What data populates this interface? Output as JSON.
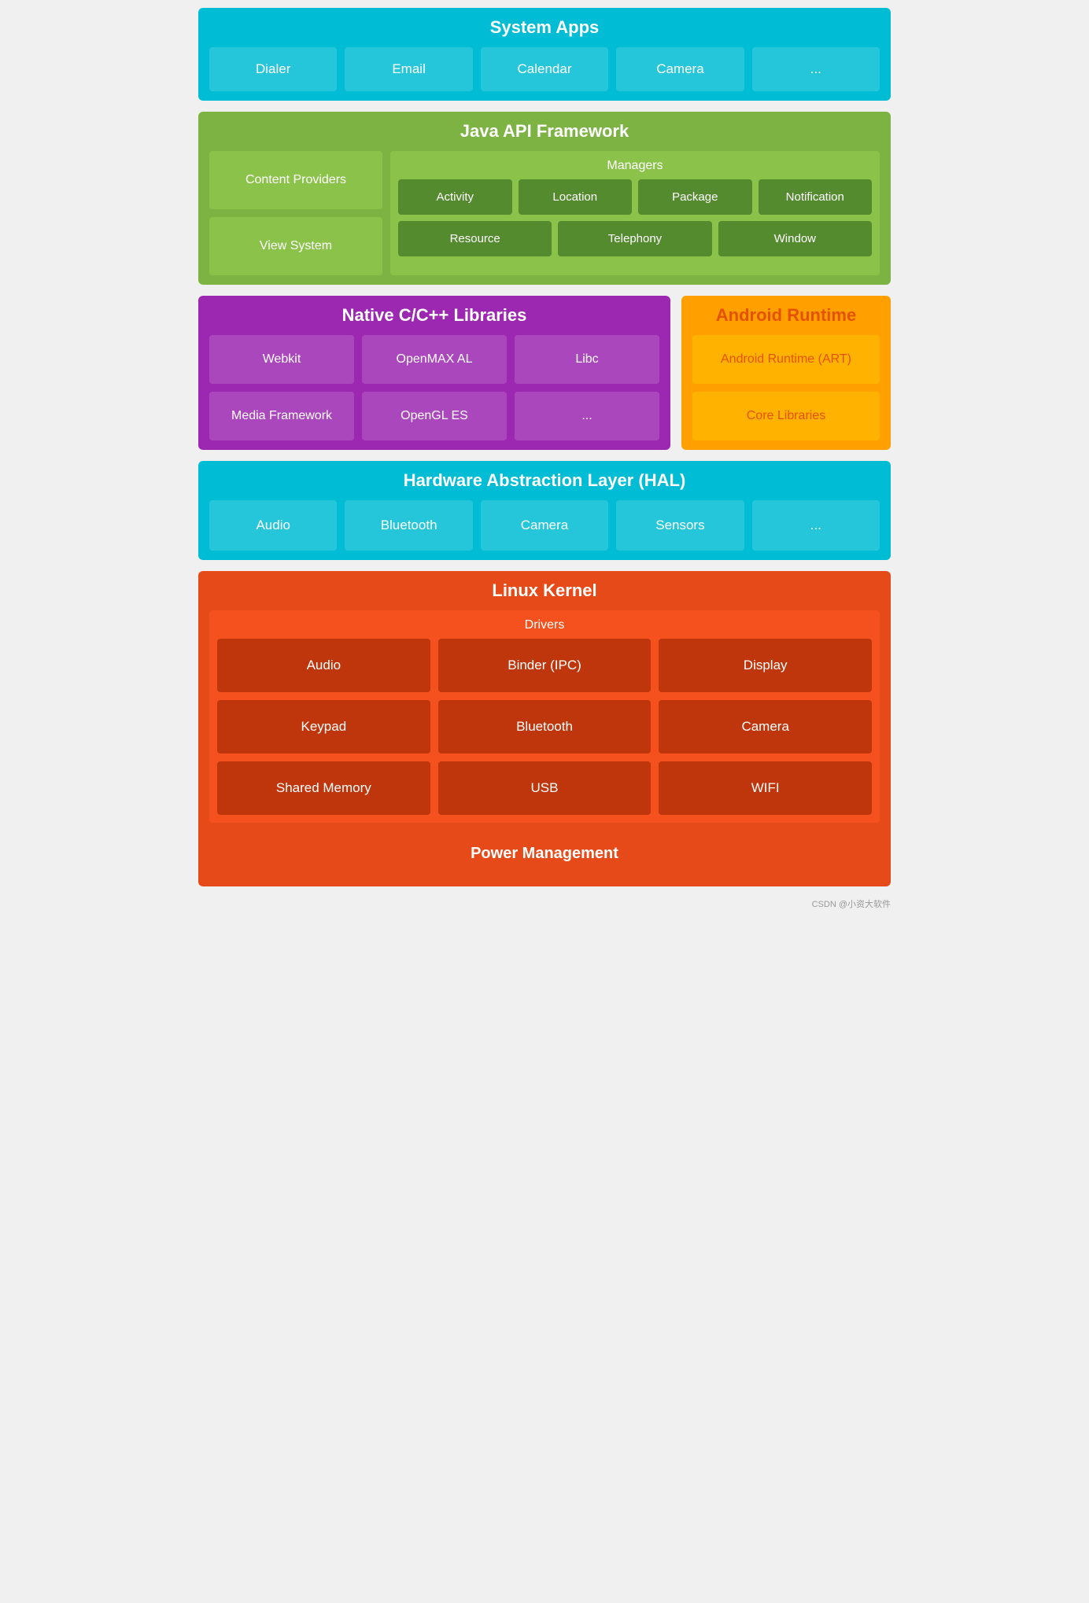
{
  "systemApps": {
    "title": "System Apps",
    "cards": [
      "Dialer",
      "Email",
      "Calendar",
      "Camera",
      "..."
    ]
  },
  "javaApi": {
    "title": "Java API Framework",
    "contentProviders": "Content Providers",
    "viewSystem": "View System",
    "managers": {
      "title": "Managers",
      "row1": [
        "Activity",
        "Location",
        "Package",
        "Notification"
      ],
      "row2": [
        "Resource",
        "Telephony",
        "Window"
      ]
    }
  },
  "native": {
    "title": "Native C/C++ Libraries",
    "row1": [
      "Webkit",
      "OpenMAX AL",
      "Libc"
    ],
    "row2": [
      "Media Framework",
      "OpenGL ES",
      "..."
    ]
  },
  "androidRuntime": {
    "title": "Android Runtime",
    "cards": [
      "Android Runtime (ART)",
      "Core Libraries"
    ]
  },
  "hal": {
    "title": "Hardware Abstraction Layer (HAL)",
    "cards": [
      "Audio",
      "Bluetooth",
      "Camera",
      "Sensors",
      "..."
    ]
  },
  "linuxKernel": {
    "title": "Linux Kernel",
    "drivers": {
      "title": "Drivers",
      "row1": [
        "Audio",
        "Binder (IPC)",
        "Display"
      ],
      "row2": [
        "Keypad",
        "Bluetooth",
        "Camera"
      ],
      "row3": [
        "Shared Memory",
        "USB",
        "WIFI"
      ]
    },
    "powerManagement": "Power Management"
  },
  "watermark": "CSDN @小资大软件"
}
